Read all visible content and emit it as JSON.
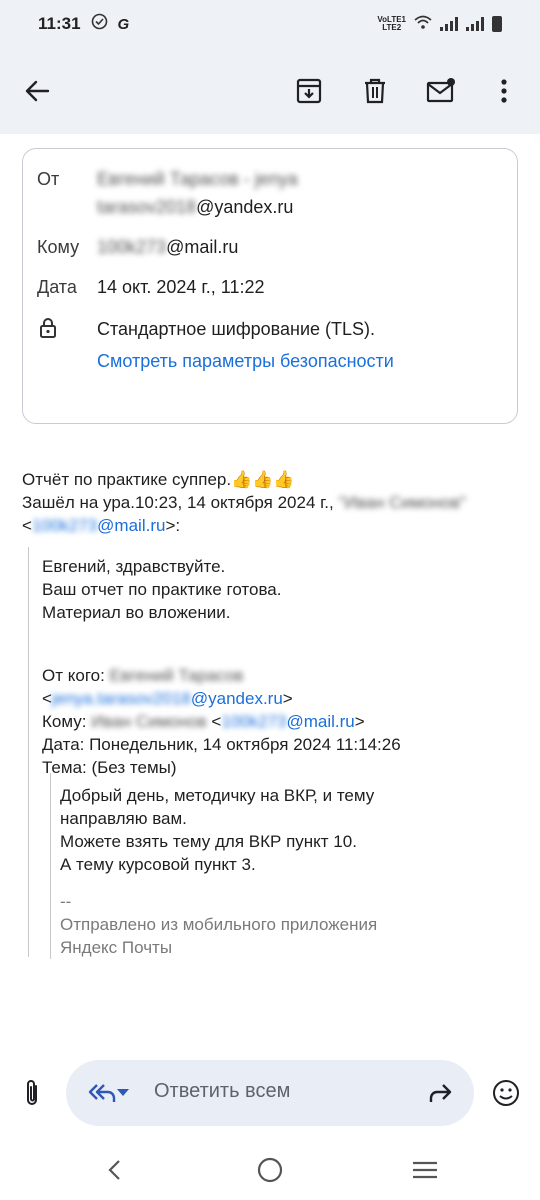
{
  "status_bar": {
    "time": "11:31",
    "network_label_top": "VoLTE1",
    "network_label_bottom": "LTE2"
  },
  "toolbar": {
    "back_icon": "arrow-back-icon",
    "archive_icon": "archive-icon",
    "delete_icon": "trash-icon",
    "mark_unread_icon": "mail-unread-icon",
    "more_icon": "more-vertical-icon"
  },
  "header": {
    "from_label": "От",
    "from_name": "Евгений Тарасов - jenya",
    "from_user": "tarasov2018",
    "from_domain": "@yandex.ru",
    "to_label": "Кому",
    "to_user": "100k273",
    "to_domain": "@mail.ru",
    "date_label": "Дата",
    "date_value": "14 окт. 2024 г., 11:22",
    "encryption_text": "Стандартное шифрование (TLS).",
    "security_link": "Смотреть параметры безопасности"
  },
  "message": {
    "line1": "Отчёт по практике суппер.👍👍👍",
    "line2_prefix": " Зашёл на ура.10:23, 14 октября 2024 г., ",
    "line2_name": "\"Иван Симонов\"",
    "line3_open": "<",
    "line3_user": "100k273",
    "line3_domain": "@mail.ru",
    "line3_close": ">:",
    "quote_line1": "Евгений, здравствуйте.",
    "quote_line2": "Ваш отчет по практике готова.",
    "quote_line3": "Материал во вложении.",
    "fwd_from_label": "От кого: ",
    "fwd_from_name": "Евгений Тарасов",
    "fwd_from_open": "<",
    "fwd_from_user": "jenya.tarasov2018",
    "fwd_from_domain": "@yandex.ru",
    "fwd_from_close": ">",
    "fwd_to_label": "Кому: ",
    "fwd_to_name": "Иван Симонов",
    "fwd_to_open": " <",
    "fwd_to_user": "100k273",
    "fwd_to_domain": "@mail.ru",
    "fwd_to_close": ">",
    "fwd_date": "Дата: Понедельник, 14 октября 2024 11:14:26",
    "fwd_subject": "Тема: (Без темы)",
    "inner_line1": "Добрый день, методичку на ВКР, и тему",
    "inner_line2": "направляю вам.",
    "inner_line3": "Можете взять тему для ВКР пункт 10.",
    "inner_line4": "А тему курсовой пункт 3.",
    "sig_dash": "--",
    "sig_line1": "Отправлено из мобильного приложения",
    "sig_line2": "Яндекс Почты"
  },
  "reply_bar": {
    "placeholder": "Ответить всем"
  },
  "colors": {
    "accent_link": "#1a6fdb",
    "app_bar_bg": "#eef1f6",
    "reply_pill_bg": "#e9eef6"
  }
}
